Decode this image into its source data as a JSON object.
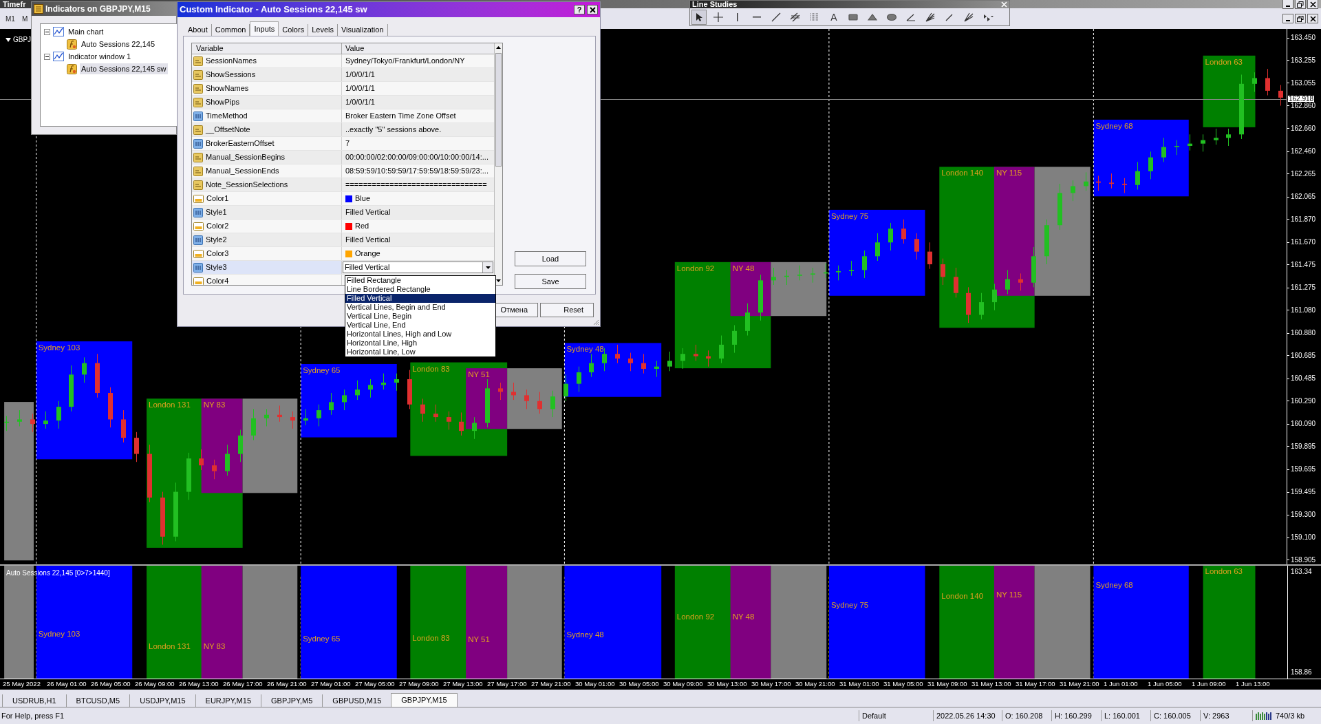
{
  "toolbar": {
    "title": "Timefr",
    "buttons": [
      "M1",
      "M"
    ]
  },
  "line_studies": {
    "title": "Line Studies",
    "tools": [
      {
        "kind": "cursor",
        "selected": true
      },
      {
        "kind": "crosshair",
        "selected": false
      },
      {
        "kind": "vline",
        "selected": false
      },
      {
        "kind": "hline",
        "selected": false
      },
      {
        "kind": "trendline",
        "selected": false
      },
      {
        "kind": "channel",
        "selected": false
      },
      {
        "kind": "fibo",
        "selected": false
      },
      {
        "kind": "text",
        "glyph": "A",
        "selected": false
      },
      {
        "kind": "rectangle",
        "selected": false
      },
      {
        "kind": "triangle",
        "selected": false
      },
      {
        "kind": "ellipse",
        "selected": false
      },
      {
        "kind": "angle",
        "selected": false
      },
      {
        "kind": "fan",
        "selected": false
      },
      {
        "kind": "gannline",
        "selected": false
      },
      {
        "kind": "fibofan",
        "selected": false
      },
      {
        "kind": "arrows",
        "selected": false
      }
    ]
  },
  "chart": {
    "symbol": "GBPJ",
    "sessions": [
      {
        "color": "#808080"
      },
      {
        "label": "Sydney 103",
        "color": "#0000ff"
      },
      {
        "label": "London 131",
        "color": "#008000"
      },
      {
        "label": "NY 83",
        "color": "#800080"
      },
      {
        "color": "#808080"
      },
      {
        "label": "Sydney 65",
        "color": "#0000ff"
      },
      {
        "label": "London 83",
        "color": "#008000"
      },
      {
        "label": "NY 51",
        "color": "#800080"
      },
      {
        "color": "#808080"
      },
      {
        "label": "Sydney 48",
        "color": "#0000ff"
      },
      {
        "label": "London 92",
        "color": "#008000"
      },
      {
        "label": "NY 48",
        "color": "#800080"
      },
      {
        "color": "#808080"
      },
      {
        "label": "Sydney 75",
        "color": "#0000ff"
      },
      {
        "label": "London 140",
        "color": "#008000"
      },
      {
        "label": "NY 115",
        "color": "#800080"
      },
      {
        "color": "#808080"
      },
      {
        "label": "Sydney 68",
        "color": "#0000ff"
      },
      {
        "label": "London 63",
        "color": "#008000"
      }
    ],
    "chart_data": {
      "type": "candlestick",
      "ylim": [
        158.869,
        163.528
      ],
      "grid": true,
      "ref_lines": [
        {
          "axis": "y",
          "value": 162.918,
          "label": "162.918"
        }
      ],
      "categories": [
        null,
        null,
        null,
        null,
        null,
        null,
        null,
        null,
        null,
        null,
        null,
        null,
        null,
        null,
        null,
        null,
        null,
        null,
        null,
        null,
        null,
        null,
        null,
        null,
        null,
        null,
        null,
        null,
        null,
        null,
        null,
        null,
        null,
        null,
        null,
        null,
        null,
        null,
        null,
        null,
        null,
        null,
        null,
        null,
        null,
        null,
        null,
        null,
        null,
        null,
        null,
        null,
        null,
        null,
        null,
        null,
        null,
        null,
        null,
        null,
        null,
        null,
        null,
        null,
        null,
        null,
        null,
        null,
        null,
        null,
        null,
        null,
        null,
        null,
        null,
        null,
        null,
        null,
        null,
        null,
        null,
        null,
        null,
        null,
        null,
        null,
        null,
        null,
        null,
        null,
        null,
        null,
        null,
        null,
        null,
        null,
        null,
        null,
        null
      ],
      "yticks": [
        {
          "value": 163.45,
          "label": "163.450"
        },
        {
          "value": 163.255,
          "label": "163.255"
        },
        {
          "value": 163.055,
          "label": "163.055"
        },
        {
          "value": 162.86,
          "label": "162.860"
        },
        {
          "value": 162.66,
          "label": "162.660"
        },
        {
          "value": 162.46,
          "label": "162.460"
        },
        {
          "value": 162.265,
          "label": "162.265"
        },
        {
          "value": 162.065,
          "label": "162.065"
        },
        {
          "value": 161.87,
          "label": "161.870"
        },
        {
          "value": 161.67,
          "label": "161.670"
        },
        {
          "value": 161.475,
          "label": "161.475"
        },
        {
          "value": 161.275,
          "label": "161.275"
        },
        {
          "value": 161.08,
          "label": "161.080"
        },
        {
          "value": 160.88,
          "label": "160.880"
        },
        {
          "value": 160.685,
          "label": "160.685"
        },
        {
          "value": 160.485,
          "label": "160.485"
        },
        {
          "value": 160.29,
          "label": "160.290"
        },
        {
          "value": 160.09,
          "label": "160.090"
        },
        {
          "value": 159.895,
          "label": "159.895"
        },
        {
          "value": 159.695,
          "label": "159.695"
        },
        {
          "value": 159.495,
          "label": "159.495"
        },
        {
          "value": 159.3,
          "label": "159.300"
        },
        {
          "value": 159.1,
          "label": "159.100"
        },
        {
          "value": 158.905,
          "label": "158.905"
        }
      ],
      "ohlc": [
        [
          160.1,
          160.16,
          160.03,
          160.11
        ],
        [
          160.11,
          160.21,
          160.07,
          160.13
        ],
        [
          160.13,
          160.18,
          160.02,
          160.09
        ],
        [
          160.09,
          160.2,
          160.05,
          160.12
        ],
        [
          160.12,
          160.29,
          160.05,
          160.24
        ],
        [
          160.24,
          160.6,
          160.2,
          160.52
        ],
        [
          160.52,
          160.67,
          160.45,
          160.62
        ],
        [
          160.62,
          160.7,
          160.32,
          160.36
        ],
        [
          160.36,
          160.41,
          160.06,
          160.13
        ],
        [
          160.13,
          160.21,
          159.93,
          159.97
        ],
        [
          159.97,
          160.02,
          159.76,
          159.83
        ],
        [
          159.83,
          159.91,
          159.41,
          159.45
        ],
        [
          159.45,
          159.5,
          159.04,
          159.11
        ],
        [
          159.11,
          159.58,
          159.07,
          159.5
        ],
        [
          159.5,
          159.84,
          159.43,
          159.79
        ],
        [
          159.79,
          159.87,
          159.69,
          159.73
        ],
        [
          159.73,
          159.78,
          159.61,
          159.68
        ],
        [
          159.68,
          159.91,
          159.64,
          159.83
        ],
        [
          159.83,
          160.04,
          159.76,
          159.99
        ],
        [
          159.99,
          160.22,
          159.95,
          160.14
        ],
        [
          160.14,
          160.22,
          160.07,
          160.17
        ],
        [
          160.17,
          160.25,
          160.11,
          160.15
        ],
        [
          160.15,
          160.2,
          160.05,
          160.12
        ],
        [
          160.12,
          160.22,
          160.08,
          160.14
        ],
        [
          160.14,
          160.26,
          160.07,
          160.21
        ],
        [
          160.21,
          160.36,
          160.17,
          160.28
        ],
        [
          160.28,
          160.39,
          160.21,
          160.34
        ],
        [
          160.34,
          160.47,
          160.3,
          160.39
        ],
        [
          160.39,
          160.48,
          160.32,
          160.43
        ],
        [
          160.43,
          160.53,
          160.39,
          160.45
        ],
        [
          160.45,
          160.53,
          160.38,
          160.48
        ],
        [
          160.48,
          160.56,
          160.22,
          160.26
        ],
        [
          160.26,
          160.31,
          160.11,
          160.18
        ],
        [
          160.18,
          160.26,
          160.11,
          160.15
        ],
        [
          160.15,
          160.2,
          160.04,
          160.11
        ],
        [
          160.11,
          160.19,
          159.99,
          160.03
        ],
        [
          160.03,
          160.15,
          159.96,
          160.1
        ],
        [
          160.1,
          160.48,
          160.06,
          160.4
        ],
        [
          160.4,
          160.45,
          160.3,
          160.37
        ],
        [
          160.37,
          160.45,
          160.3,
          160.34
        ],
        [
          160.34,
          160.39,
          160.22,
          160.29
        ],
        [
          160.29,
          160.37,
          160.18,
          160.22
        ],
        [
          160.22,
          160.38,
          160.15,
          160.33
        ],
        [
          160.33,
          160.52,
          160.29,
          160.44
        ],
        [
          160.44,
          160.59,
          160.37,
          160.54
        ],
        [
          160.54,
          160.7,
          160.5,
          160.62
        ],
        [
          160.62,
          160.75,
          160.55,
          160.7
        ],
        [
          160.7,
          160.78,
          160.62,
          160.66
        ],
        [
          160.66,
          160.71,
          160.55,
          160.62
        ],
        [
          160.62,
          160.7,
          160.53,
          160.57
        ],
        [
          160.57,
          160.64,
          160.5,
          160.59
        ],
        [
          160.59,
          160.72,
          160.55,
          160.64
        ],
        [
          160.64,
          160.75,
          160.57,
          160.7
        ],
        [
          160.7,
          160.78,
          160.64,
          160.68
        ],
        [
          160.68,
          160.73,
          160.59,
          160.66
        ],
        [
          160.66,
          160.86,
          160.62,
          160.78
        ],
        [
          160.78,
          160.95,
          160.71,
          160.9
        ],
        [
          160.9,
          161.14,
          160.86,
          161.06
        ],
        [
          161.06,
          161.39,
          160.99,
          161.34
        ],
        [
          161.34,
          161.45,
          161.3,
          161.37
        ],
        [
          161.37,
          161.43,
          161.3,
          161.38
        ],
        [
          161.38,
          161.47,
          161.34,
          161.39
        ],
        [
          161.39,
          161.45,
          161.32,
          161.4
        ],
        [
          161.4,
          161.49,
          161.36,
          161.41
        ],
        [
          161.41,
          161.47,
          161.34,
          161.42
        ],
        [
          161.42,
          161.51,
          161.38,
          161.43
        ],
        [
          161.43,
          161.6,
          161.36,
          161.55
        ],
        [
          161.55,
          161.75,
          161.51,
          161.67
        ],
        [
          161.67,
          161.84,
          161.6,
          161.79
        ],
        [
          161.79,
          161.87,
          161.66,
          161.7
        ],
        [
          161.7,
          161.75,
          161.52,
          161.59
        ],
        [
          161.59,
          161.67,
          161.44,
          161.48
        ],
        [
          161.48,
          161.53,
          161.3,
          161.37
        ],
        [
          161.37,
          161.45,
          161.19,
          161.23
        ],
        [
          161.23,
          161.28,
          160.97,
          161.04
        ],
        [
          161.04,
          161.23,
          161.0,
          161.15
        ],
        [
          161.15,
          161.31,
          161.08,
          161.26
        ],
        [
          161.26,
          161.43,
          161.22,
          161.35
        ],
        [
          161.35,
          161.4,
          161.25,
          161.32
        ],
        [
          161.32,
          161.63,
          161.28,
          161.55
        ],
        [
          161.55,
          161.87,
          161.48,
          161.82
        ],
        [
          161.82,
          162.18,
          161.78,
          162.1
        ],
        [
          162.1,
          162.21,
          162.03,
          162.16
        ],
        [
          162.16,
          162.28,
          162.12,
          162.2
        ],
        [
          162.2,
          162.25,
          162.12,
          162.19
        ],
        [
          162.19,
          162.27,
          162.14,
          162.18
        ],
        [
          162.18,
          162.23,
          162.1,
          162.17
        ],
        [
          162.17,
          162.37,
          162.13,
          162.29
        ],
        [
          162.29,
          162.46,
          162.22,
          162.41
        ],
        [
          162.41,
          162.58,
          162.37,
          162.5
        ],
        [
          162.5,
          162.56,
          162.43,
          162.51
        ],
        [
          162.51,
          162.61,
          162.47,
          162.53
        ],
        [
          162.53,
          162.61,
          162.46,
          162.56
        ],
        [
          162.56,
          162.66,
          162.52,
          162.58
        ],
        [
          162.58,
          162.66,
          162.51,
          162.61
        ],
        [
          162.61,
          163.13,
          162.57,
          163.05
        ],
        [
          163.05,
          163.15,
          162.98,
          163.1
        ],
        [
          163.1,
          163.18,
          162.95,
          162.99
        ],
        [
          162.99,
          163.04,
          162.86,
          162.93
        ]
      ]
    },
    "indicator_pane": {
      "title": "Auto Sessions 22,145 [0>7>1440]",
      "price_labels": [
        "163.34",
        "158.86"
      ],
      "sessions": [
        {
          "color": "#808080"
        },
        {
          "label": "Sydney 103",
          "color": "#0000ff"
        },
        {
          "label": "London 131",
          "color": "#008000"
        },
        {
          "label": "NY 83",
          "color": "#800080"
        },
        {
          "color": "#808080"
        },
        {
          "label": "Sydney 65",
          "color": "#0000ff"
        },
        {
          "label": "London 83",
          "color": "#008000"
        },
        {
          "label": "NY 51",
          "color": "#800080"
        },
        {
          "color": "#808080"
        },
        {
          "label": "Sydney 48",
          "color": "#0000ff"
        },
        {
          "label": "London 92",
          "color": "#008000"
        },
        {
          "label": "NY 48",
          "color": "#800080"
        },
        {
          "color": "#808080"
        },
        {
          "label": "Sydney 75",
          "color": "#0000ff"
        },
        {
          "label": "London 140",
          "color": "#008000"
        },
        {
          "label": "NY 115",
          "color": "#800080"
        },
        {
          "color": "#808080"
        },
        {
          "label": "Sydney 68",
          "color": "#0000ff"
        },
        {
          "label": "London 63",
          "color": "#008000"
        }
      ]
    },
    "time_labels": [
      "25 May 2022",
      "26 May 01:00",
      "26 May 05:00",
      "26 May 09:00",
      "26 May 13:00",
      "26 May 17:00",
      "26 May 21:00",
      "27 May 01:00",
      "27 May 05:00",
      "27 May 09:00",
      "27 May 13:00",
      "27 May 17:00",
      "27 May 21:00",
      "30 May 01:00",
      "30 May 05:00",
      "30 May 09:00",
      "30 May 13:00",
      "30 May 17:00",
      "30 May 21:00",
      "31 May 01:00",
      "31 May 05:00",
      "31 May 09:00",
      "31 May 13:00",
      "31 May 17:00",
      "31 May 21:00",
      "1 Jun 01:00",
      "1 Jun 05:00",
      "1 Jun 09:00",
      "1 Jun 13:00"
    ]
  },
  "indicators_window": {
    "title": "Indicators on GBPJPY,M15",
    "tree": [
      {
        "label": "Main chart",
        "kind": "chart",
        "expanded": true,
        "selected": false,
        "children": [
          {
            "label": "Auto Sessions 22,145",
            "kind": "indicator",
            "selected": false
          }
        ]
      },
      {
        "label": "Indicator window 1",
        "kind": "chart",
        "expanded": true,
        "selected": false,
        "children": [
          {
            "label": "Auto Sessions 22,145 sw",
            "kind": "indicator",
            "selected": true
          }
        ]
      }
    ]
  },
  "dialog": {
    "title": "Custom Indicator - Auto Sessions 22,145 sw",
    "help_button": "?",
    "tabs": [
      {
        "label": "About",
        "selected": false
      },
      {
        "label": "Common",
        "selected": false
      },
      {
        "label": "Inputs",
        "selected": true
      },
      {
        "label": "Colors",
        "selected": false
      },
      {
        "label": "Levels",
        "selected": false
      },
      {
        "label": "Visualization",
        "selected": false
      }
    ],
    "columns": [
      "Variable",
      "Value"
    ],
    "rows": [
      {
        "variable": "SessionNames",
        "value": "Sydney/Tokyo/Frankfurt/London/NY",
        "kind": "string",
        "selected": false
      },
      {
        "variable": "ShowSessions",
        "value": "1/0/0/1/1",
        "kind": "string",
        "selected": false
      },
      {
        "variable": "ShowNames",
        "value": "1/0/0/1/1",
        "kind": "string",
        "selected": false
      },
      {
        "variable": "ShowPips",
        "value": "1/0/0/1/1",
        "kind": "string",
        "selected": false
      },
      {
        "variable": "TimeMethod",
        "value": "Broker Eastern Time Zone Offset",
        "kind": "int",
        "selected": false
      },
      {
        "variable": "__OffsetNote",
        "value": "..exactly \"5\" sessions above.",
        "kind": "string",
        "selected": false
      },
      {
        "variable": "BrokerEasternOffset",
        "value": "7",
        "kind": "int",
        "selected": false
      },
      {
        "variable": "Manual_SessionBegins",
        "value": "00:00:00/02:00:00/09:00:00/10:00:00/14:...",
        "kind": "string",
        "selected": false
      },
      {
        "variable": "Manual_SessionEnds",
        "value": "08:59:59/10:59:59/17:59:59/18:59:59/23:...",
        "kind": "string",
        "selected": false
      },
      {
        "variable": "Note_SessionSelections",
        "value": "================================",
        "kind": "string",
        "selected": false
      },
      {
        "variable": "Color1",
        "value": "Blue",
        "kind": "color",
        "color": "#0000ff",
        "selected": false
      },
      {
        "variable": "Style1",
        "value": "Filled Vertical",
        "kind": "int",
        "selected": false
      },
      {
        "variable": "Color2",
        "value": "Red",
        "kind": "color",
        "color": "#ff0000",
        "selected": false
      },
      {
        "variable": "Style2",
        "value": "Filled Vertical",
        "kind": "int",
        "selected": false
      },
      {
        "variable": "Color3",
        "value": "Orange",
        "kind": "color",
        "color": "#ffa500",
        "selected": false
      },
      {
        "variable": "Style3",
        "value": "Filled Vertical",
        "kind": "int",
        "selected": true
      },
      {
        "variable": "Color4",
        "kind": "color",
        "selected": false
      }
    ],
    "dropdown": [
      {
        "label": "Filled Rectangle",
        "selected": false
      },
      {
        "label": "Line Bordered Rectangle",
        "selected": false
      },
      {
        "label": "Filled Vertical",
        "selected": true
      },
      {
        "label": "Vertical Lines, Begin and End",
        "selected": false
      },
      {
        "label": "Vertical Line, Begin",
        "selected": false
      },
      {
        "label": "Vertical Line, End",
        "selected": false
      },
      {
        "label": "Horizontal Lines, High and Low",
        "selected": false
      },
      {
        "label": "Horizontal Line, High",
        "selected": false
      },
      {
        "label": "Horizontal Line, Low",
        "selected": false
      }
    ],
    "side_buttons": [
      "Load",
      "Save"
    ],
    "bottom_buttons": [
      "Отмена",
      "Reset"
    ]
  },
  "chart_tabs": [
    {
      "label": "USDRUB,H1",
      "selected": false
    },
    {
      "label": "BTCUSD,M5",
      "selected": false
    },
    {
      "label": "USDJPY,M15",
      "selected": false
    },
    {
      "label": "EURJPY,M15",
      "selected": false
    },
    {
      "label": "GBPJPY,M5",
      "selected": false
    },
    {
      "label": "GBPUSD,M15",
      "selected": false
    },
    {
      "label": "GBPJPY,M15",
      "selected": true
    }
  ],
  "status_bar": {
    "help": "For Help, press F1",
    "profile": "Default",
    "time": "2022.05.26 14:30",
    "open": "O: 160.208",
    "high": "H: 160.299",
    "low": "L: 160.001",
    "close": "C: 160.005",
    "volume": "V: 2963",
    "traffic": "740/3 kb"
  }
}
